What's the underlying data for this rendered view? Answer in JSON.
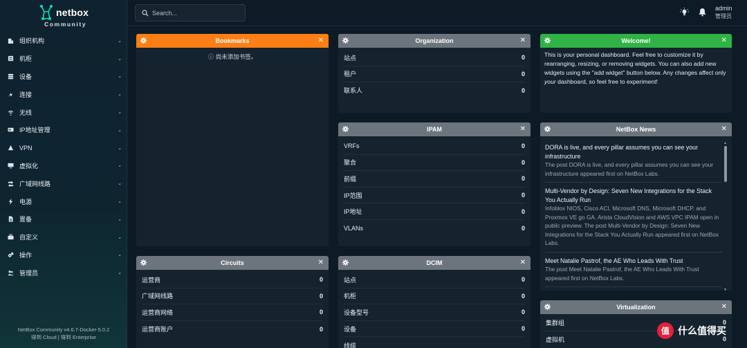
{
  "brand": {
    "name": "netbox",
    "edition": "Community"
  },
  "sidebar": {
    "items": [
      {
        "label": "组织机构",
        "icon": "building-icon"
      },
      {
        "label": "机柜",
        "icon": "rack-icon"
      },
      {
        "label": "设备",
        "icon": "server-icon"
      },
      {
        "label": "连接",
        "icon": "cable-icon"
      },
      {
        "label": "无线",
        "icon": "wifi-icon"
      },
      {
        "label": "IP地址管理",
        "icon": "counter-icon"
      },
      {
        "label": "VPN",
        "icon": "tunnel-icon"
      },
      {
        "label": "虚拟化",
        "icon": "monitor-icon"
      },
      {
        "label": "广域网线路",
        "icon": "transit-icon"
      },
      {
        "label": "电源",
        "icon": "flash-icon"
      },
      {
        "label": "置备",
        "icon": "file-document-icon"
      },
      {
        "label": "自定义",
        "icon": "toolbox-icon"
      },
      {
        "label": "操作",
        "icon": "cogs-icon"
      },
      {
        "label": "管理员",
        "icon": "account-group-icon"
      }
    ],
    "footer_line1": "NetBox Community v4.6.7-Docker-5.0.2",
    "footer_line2": "得到 Cloud | 得到 Enterprise"
  },
  "topbar": {
    "search_placeholder": "Search...",
    "username": "admin",
    "role": "管理员"
  },
  "widgets": {
    "bookmarks": {
      "title": "Bookmarks",
      "empty": "尚未添加书签。"
    },
    "organization": {
      "title": "Organization",
      "rows": [
        {
          "label": "站点",
          "value": "0"
        },
        {
          "label": "租户",
          "value": "0"
        },
        {
          "label": "联系人",
          "value": "0"
        }
      ]
    },
    "welcome": {
      "title": "Welcome!",
      "text_a": "This is your personal dashboard. Feel free to customize it by rearranging, resizing, or removing widgets. You can also add new widgets using the \"add widget\" button below. Any changes affect only ",
      "text_em": "your",
      "text_b": " dashboard, so feel free to experiment!"
    },
    "ipam": {
      "title": "IPAM",
      "rows": [
        {
          "label": "VRFs",
          "value": "0"
        },
        {
          "label": "聚合",
          "value": "0"
        },
        {
          "label": "前缀",
          "value": "0"
        },
        {
          "label": "IP范围",
          "value": "0"
        },
        {
          "label": "IP地址",
          "value": "0"
        },
        {
          "label": "VLANs",
          "value": "0"
        }
      ]
    },
    "news": {
      "title": "NetBox News",
      "items": [
        {
          "title": "DORA is live, and every pillar assumes you can see your infrastructure",
          "text": "The post DORA is live, and every pillar assumes you can see your infrastructure appeared first on NetBox Labs."
        },
        {
          "title": "Multi-Vendor by Design: Seven New Integrations for the Stack You Actually Run",
          "text": "Infoblox NIOS, Cisco ACI, Microsoft DNS, Microsoft DHCP, and Proxmox VE go GA. Arista CloudVision and AWS VPC IPAM open in public preview. The post Multi-Vendor by Design: Seven New Integrations for the Stack You Actually Run appeared first on NetBox Labs."
        },
        {
          "title": "Meet Natalie Pastrof, the AE Who Leads With Trust",
          "text": "The post Meet Natalie Pastrof, the AE Who Leads With Trust appeared first on NetBox Labs."
        }
      ]
    },
    "circuits": {
      "title": "Circuits",
      "rows": [
        {
          "label": "运营商",
          "value": "0"
        },
        {
          "label": "广域网线路",
          "value": "0"
        },
        {
          "label": "运营商网络",
          "value": "0"
        },
        {
          "label": "运营商账户",
          "value": "0"
        }
      ]
    },
    "dcim": {
      "title": "DCIM",
      "rows": [
        {
          "label": "站点",
          "value": "0"
        },
        {
          "label": "机柜",
          "value": "0"
        },
        {
          "label": "设备型号",
          "value": "0"
        },
        {
          "label": "设备",
          "value": "0"
        },
        {
          "label": "线缆",
          "value": ""
        }
      ]
    },
    "virtualization": {
      "title": "Virtualization",
      "rows": [
        {
          "label": "集群组",
          "value": "0"
        },
        {
          "label": "虚拟机",
          "value": "0"
        }
      ]
    }
  },
  "watermark": {
    "text": "什么值得买",
    "icon": "zhi-icon"
  },
  "colors": {
    "background": "#0d1b27",
    "card": "#15232f",
    "header_grey": "#6c757d",
    "header_orange": "#fd7e14",
    "header_green": "#2fb344"
  }
}
